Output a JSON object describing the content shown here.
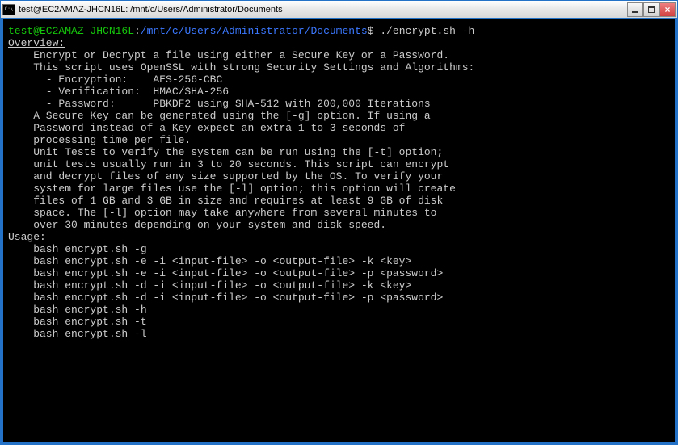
{
  "window": {
    "title": "test@EC2AMAZ-JHCN16L: /mnt/c/Users/Administrator/Documents"
  },
  "prompt": {
    "user_host": "test@EC2AMAZ-JHCN16L",
    "separator": ":",
    "path": "/mnt/c/Users/Administrator/Documents",
    "dollar": "$",
    "command": "./encrypt.sh -h"
  },
  "output": {
    "blank_top": "",
    "overview_header": "Overview:",
    "overview_lines": [
      "    Encrypt or Decrypt a file using either a Secure Key or a Password.",
      "",
      "    This script uses OpenSSL with strong Security Settings and Algorithms:",
      "      - Encryption:    AES-256-CBC",
      "      - Verification:  HMAC/SHA-256",
      "      - Password:      PBKDF2 using SHA-512 with 200,000 Iterations",
      "",
      "    A Secure Key can be generated using the [-g] option. If using a",
      "    Password instead of a Key expect an extra 1 to 3 seconds of",
      "    processing time per file.",
      "",
      "    Unit Tests to verify the system can be run using the [-t] option;",
      "    unit tests usually run in 3 to 20 seconds. This script can encrypt",
      "    and decrypt files of any size supported by the OS. To verify your",
      "    system for large files use the [-l] option; this option will create",
      "    files of 1 GB and 3 GB in size and requires at least 9 GB of disk",
      "    space. The [-l] option may take anywhere from several minutes to",
      "    over 30 minutes depending on your system and disk speed.",
      ""
    ],
    "usage_header": "Usage:",
    "usage_lines": [
      "    bash encrypt.sh -g",
      "    bash encrypt.sh -e -i <input-file> -o <output-file> -k <key>",
      "    bash encrypt.sh -e -i <input-file> -o <output-file> -p <password>",
      "    bash encrypt.sh -d -i <input-file> -o <output-file> -k <key>",
      "    bash encrypt.sh -d -i <input-file> -o <output-file> -p <password>",
      "    bash encrypt.sh -h",
      "    bash encrypt.sh -t",
      "    bash encrypt.sh -l"
    ]
  }
}
